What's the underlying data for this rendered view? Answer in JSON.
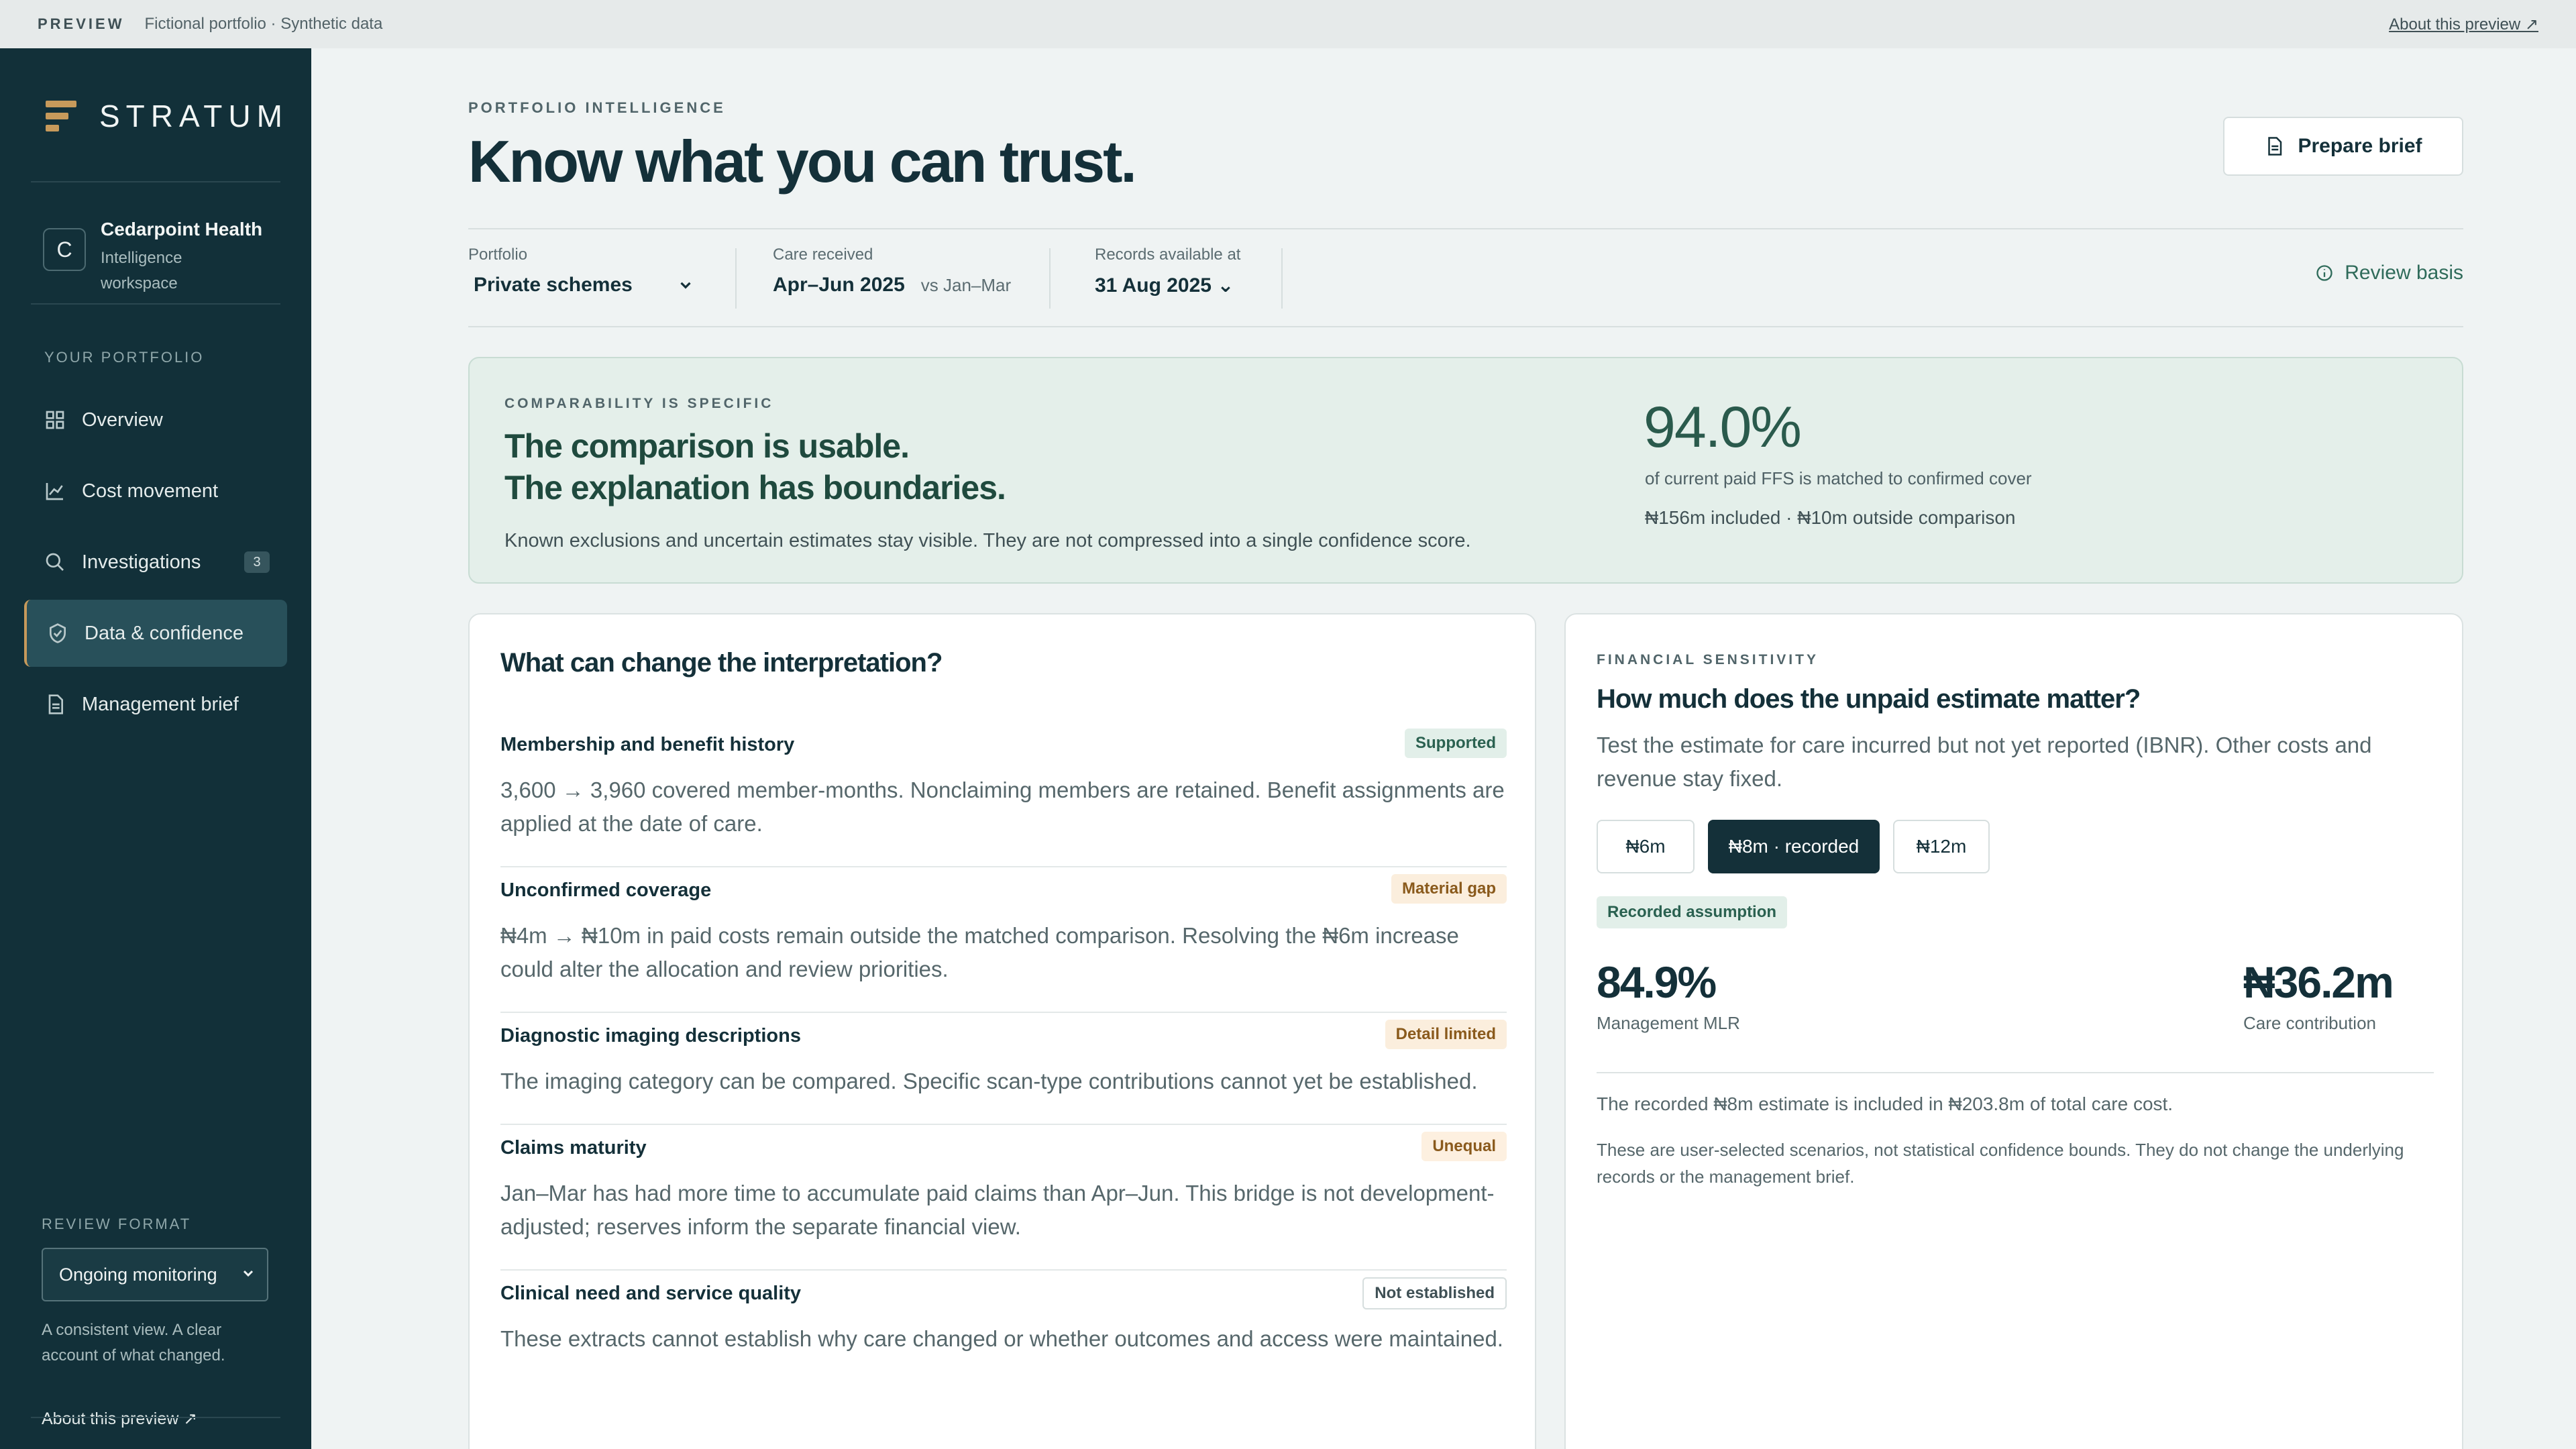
{
  "topbar": {
    "preview": "PREVIEW",
    "subtitle": "Fictional portfolio · Synthetic data",
    "about": "About this preview ↗"
  },
  "sidebar": {
    "brand": "STRATUM",
    "workspace": {
      "initial": "C",
      "name": "Cedarpoint Health",
      "sub": "Intelligence workspace"
    },
    "section_label": "YOUR PORTFOLIO",
    "items": [
      {
        "label": "Overview",
        "icon": "grid-icon"
      },
      {
        "label": "Cost movement",
        "icon": "line-chart-icon"
      },
      {
        "label": "Investigations",
        "icon": "search-icon",
        "badge": "3"
      },
      {
        "label": "Data & confidence",
        "icon": "shield-check-icon",
        "active": true
      },
      {
        "label": "Management brief",
        "icon": "document-icon"
      }
    ],
    "review_format_label": "REVIEW FORMAT",
    "review_format_value": "Ongoing monitoring",
    "review_note": "A consistent view. A clear account of what changed.",
    "about": "About this preview ↗"
  },
  "header": {
    "eyebrow": "PORTFOLIO INTELLIGENCE",
    "title": "Know what you can trust.",
    "prepare": "Prepare brief"
  },
  "filters": {
    "portfolio_label": "Portfolio",
    "portfolio_value": "Private schemes",
    "care_label": "Care received",
    "care_value": "Apr–Jun 2025",
    "care_vs": "vs Jan–Mar",
    "records_label": "Records available at",
    "records_value": "31 Aug 2025 ⌄",
    "review_basis": "Review basis"
  },
  "banner": {
    "eyebrow": "COMPARABILITY IS SPECIFIC",
    "line1": "The comparison is usable.",
    "line2": "The explanation has boundaries.",
    "sub": "Known exclusions and uncertain estimates stay visible. They are not compressed into a single confidence score.",
    "pct": "94.0%",
    "pct_desc": "of current paid FFS is matched to confirmed cover",
    "pct_sub": "₦156m included · ₦10m outside comparison"
  },
  "interpretation": {
    "title": "What can change the interpretation?",
    "items": [
      {
        "title": "Membership and benefit history",
        "tag": "Supported",
        "tag_bg": "#e2efe9",
        "tag_fg": "#2a6150",
        "body": "3,600 → 3,960 covered member-months. Nonclaiming members are retained. Benefit assignments are applied at the date of care."
      },
      {
        "title": "Unconfirmed coverage",
        "tag": "Material gap",
        "tag_bg": "#fbeedd",
        "tag_fg": "#8a5a1c",
        "body": "₦4m → ₦10m in paid costs remain outside the matched comparison. Resolving the ₦6m increase could alter the allocation and review priorities."
      },
      {
        "title": "Diagnostic imaging descriptions",
        "tag": "Detail limited",
        "tag_bg": "#fbeedd",
        "tag_fg": "#8a5a1c",
        "body": "The imaging category can be compared. Specific scan-type contributions cannot yet be established."
      },
      {
        "title": "Claims maturity",
        "tag": "Unequal",
        "tag_bg": "#fdf0e0",
        "tag_fg": "#8a5a1c",
        "body": "Jan–Mar has had more time to accumulate paid claims than Apr–Jun. This bridge is not development-adjusted; reserves inform the separate financial view."
      },
      {
        "title": "Clinical need and service quality",
        "tag": "Not established",
        "tag_bg": "#ffffff",
        "tag_fg": "#3f5055",
        "body": "These extracts cannot establish why care changed or whether outcomes and access were maintained."
      }
    ]
  },
  "sensitivity": {
    "eyebrow": "FINANCIAL SENSITIVITY",
    "title": "How much does the unpaid estimate matter?",
    "desc": "Test the estimate for care incurred but not yet reported (IBNR). Other costs and revenue stay fixed.",
    "options": [
      "₦6m",
      "₦8m · recorded",
      "₦12m"
    ],
    "selected": "₦8m · recorded",
    "recorded_tag": "Recorded assumption",
    "mlr_value": "84.9%",
    "mlr_label": "Management MLR",
    "care_value": "₦36.2m",
    "care_label": "Care contribution",
    "note1": "The recorded ₦8m estimate is included in ₦203.8m of total care cost.",
    "note2": "These are user-selected scenarios, not statistical confidence bounds. They do not change the underlying records or the management brief."
  }
}
